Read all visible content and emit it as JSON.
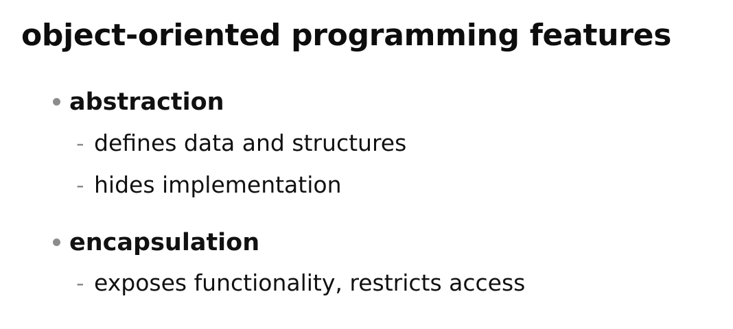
{
  "slide": {
    "title": "object-oriented programming features",
    "bullets": [
      {
        "label": "abstraction",
        "subitems": [
          {
            "dash": "-",
            "text": "defines data and structures"
          },
          {
            "dash": "-",
            "text": "hides implementation"
          }
        ]
      },
      {
        "label": "encapsulation",
        "subitems": [
          {
            "dash": "-",
            "text": "exposes functionality, restricts access"
          }
        ]
      }
    ]
  },
  "colors": {
    "background": "#ffffff",
    "text": "#111111",
    "bullet_marker": "#8c8c8c"
  }
}
